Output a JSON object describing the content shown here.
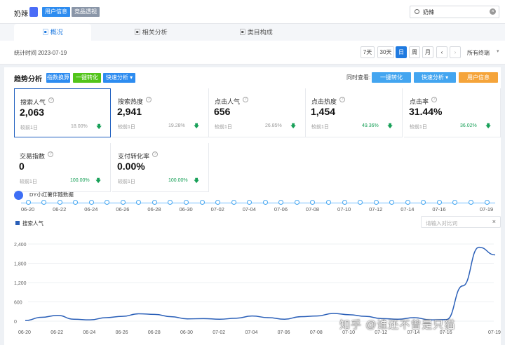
{
  "header": {
    "title": "奶辣",
    "tags": [
      {
        "label": "用户信息",
        "color": "#2d8cf0"
      },
      {
        "label": "竞品透视",
        "color": "#8a96a8"
      }
    ],
    "search_value": "奶辣"
  },
  "tabs": [
    {
      "label": "概况",
      "active": true
    },
    {
      "label": "相关分析",
      "active": false
    },
    {
      "label": "类目构成",
      "active": false
    }
  ],
  "datebar": {
    "stat_time": "统计时间 2023-07-19",
    "ranges": [
      "7天",
      "30天",
      "日",
      "周",
      "月"
    ],
    "active_range": "日",
    "source_select": "所有终端"
  },
  "trend": {
    "title": "趋势分析",
    "buttons": [
      {
        "label": "指数换算",
        "color": "#2d8cf0"
      },
      {
        "label": "一键转化",
        "color": "#52c41a"
      },
      {
        "label": "快速分析",
        "color": "#2d8cf0"
      }
    ],
    "sync_label": "同时查看:",
    "right_buttons": [
      {
        "label": "一键转化",
        "color": "#43a5f0"
      },
      {
        "label": "快速分析",
        "color": "#43a5f0"
      },
      {
        "label": "用户信息",
        "color": "#f5a43a"
      }
    ]
  },
  "metrics": [
    {
      "label": "搜索人气",
      "value": "2,063",
      "prev": "较前1日",
      "pct": "18.00%",
      "green": false,
      "selected": true
    },
    {
      "label": "搜索热度",
      "value": "2,941",
      "prev": "较前1日",
      "pct": "19.28%",
      "green": false,
      "selected": false
    },
    {
      "label": "点击人气",
      "value": "656",
      "prev": "较前1日",
      "pct": "26.85%",
      "green": false,
      "selected": false
    },
    {
      "label": "点击热度",
      "value": "1,454",
      "prev": "较前1日",
      "pct": "49.36%",
      "green": true,
      "selected": false
    },
    {
      "label": "点击率",
      "value": "31.44%",
      "prev": "较前1日",
      "pct": "36.02%",
      "green": true,
      "selected": false
    },
    {
      "label": "交易指数",
      "value": "0",
      "prev": "较前1日",
      "pct": "100.00%",
      "green": true,
      "selected": false
    },
    {
      "label": "支付转化率",
      "value": "0.00%",
      "prev": "较前1日",
      "pct": "100.00%",
      "green": true,
      "selected": false
    }
  ],
  "timeline": {
    "logo_text": "DY小红薯伴随数据",
    "labels": [
      "06-20",
      "06-22",
      "06-24",
      "06-26",
      "06-28",
      "06-30",
      "07-02",
      "07-04",
      "07-06",
      "07-08",
      "07-10",
      "07-12",
      "07-14",
      "07-16",
      "07-19"
    ]
  },
  "chart_compare_placeholder": "请输入对比词",
  "chart_data": {
    "type": "line",
    "series": [
      {
        "name": "搜索人气",
        "color": "#2a5fb8",
        "x": [
          "06-20",
          "06-21",
          "06-22",
          "06-23",
          "06-24",
          "06-25",
          "06-26",
          "06-27",
          "06-28",
          "06-29",
          "06-30",
          "07-01",
          "07-02",
          "07-03",
          "07-04",
          "07-05",
          "07-06",
          "07-07",
          "07-08",
          "07-09",
          "07-10",
          "07-11",
          "07-12",
          "07-13",
          "07-14",
          "07-15",
          "07-16",
          "07-17",
          "07-18",
          "07-19"
        ],
        "values": [
          20,
          120,
          180,
          60,
          40,
          110,
          150,
          230,
          210,
          140,
          70,
          80,
          60,
          90,
          160,
          110,
          60,
          140,
          160,
          240,
          200,
          150,
          80,
          60,
          110,
          40,
          50,
          1100,
          2300,
          2063
        ]
      }
    ],
    "yticks": [
      "0",
      "600",
      "1,200",
      "1,800",
      "2,400"
    ],
    "ylim": [
      0,
      2400
    ],
    "xticks": [
      "06-20",
      "06-22",
      "06-24",
      "06-26",
      "06-28",
      "06-30",
      "07-02",
      "07-04",
      "07-06",
      "07-08",
      "07-10",
      "07-12",
      "07-14",
      "07-16",
      "07-19"
    ]
  },
  "watermark": "知乎 @谁还不曾是只猫"
}
